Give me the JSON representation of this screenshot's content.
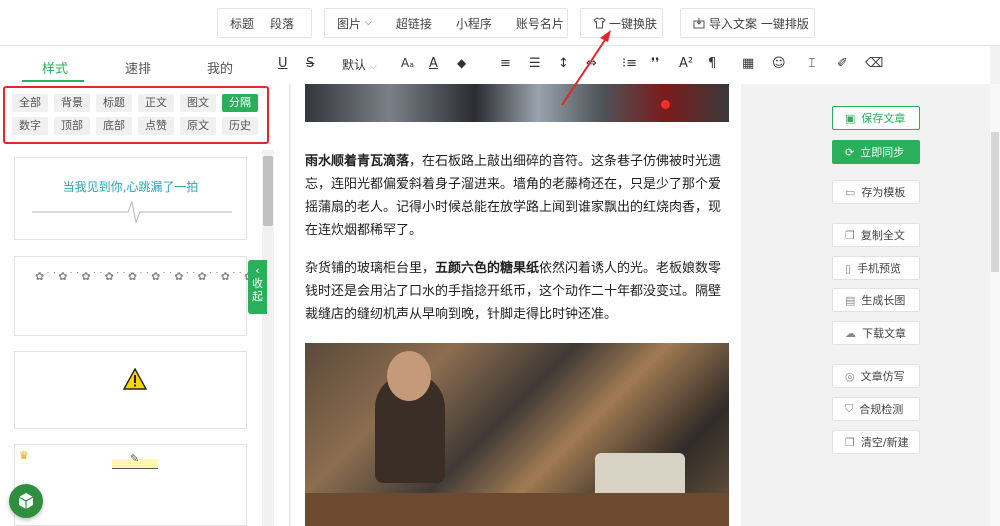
{
  "toolbar": {
    "group1": [
      "标题",
      "段落"
    ],
    "group2": [
      "图片",
      "超链接",
      "小程序",
      "账号名片"
    ],
    "theme_button": "一键换肤",
    "import_button": "导入文案 一键排版"
  },
  "left_panel": {
    "tabs": [
      "样式",
      "速排",
      "我的"
    ],
    "active_tab": "样式",
    "filters_row1": [
      "全部",
      "背景",
      "标题",
      "正文",
      "图文",
      "分隔"
    ],
    "filters_row2": [
      "数字",
      "顶部",
      "底部",
      "点赞",
      "原文",
      "历史"
    ],
    "active_filter": "分隔",
    "card1_text": "当我见到你,心跳漏了一拍",
    "collapse_label": [
      "收",
      "起"
    ]
  },
  "format_bar": {
    "font_default": "默认"
  },
  "article": {
    "para1_bold": "雨水顺着青瓦滴落",
    "para1_rest": "，在石板路上敲出细碎的音符。这条巷子仿佛被时光遗忘，连阳光都偏爱斜着身子溜进来。墙角的老藤椅还在，只是少了那个爱摇蒲扇的老人。记得小时候总能在放学路上闻到谁家飘出的红烧肉香，现在连炊烟都稀罕了。",
    "para2_start": "杂货铺的玻璃柜台里，",
    "para2_bold": "五颜六色的糖果纸",
    "para2_rest": "依然闪着诱人的光。老板娘数零钱时还是会用沾了口水的手指捻开纸币，这个动作二十年都没变过。隔壁裁缝店的缝纫机声从早响到晚，针脚走得比时钟还准。"
  },
  "right_panel": {
    "save": "保存文章",
    "sync": "立即同步",
    "save_template": "存为模板",
    "copy_all": "复制全文",
    "phone_preview": "手机预览",
    "long_image": "生成长图",
    "download": "下载文章",
    "rewrite": "文章仿写",
    "compliance": "合规检测",
    "clear_new": "清空/新建"
  },
  "colors": {
    "accent": "#2aaf5a",
    "highlight_box": "#e4262a"
  }
}
